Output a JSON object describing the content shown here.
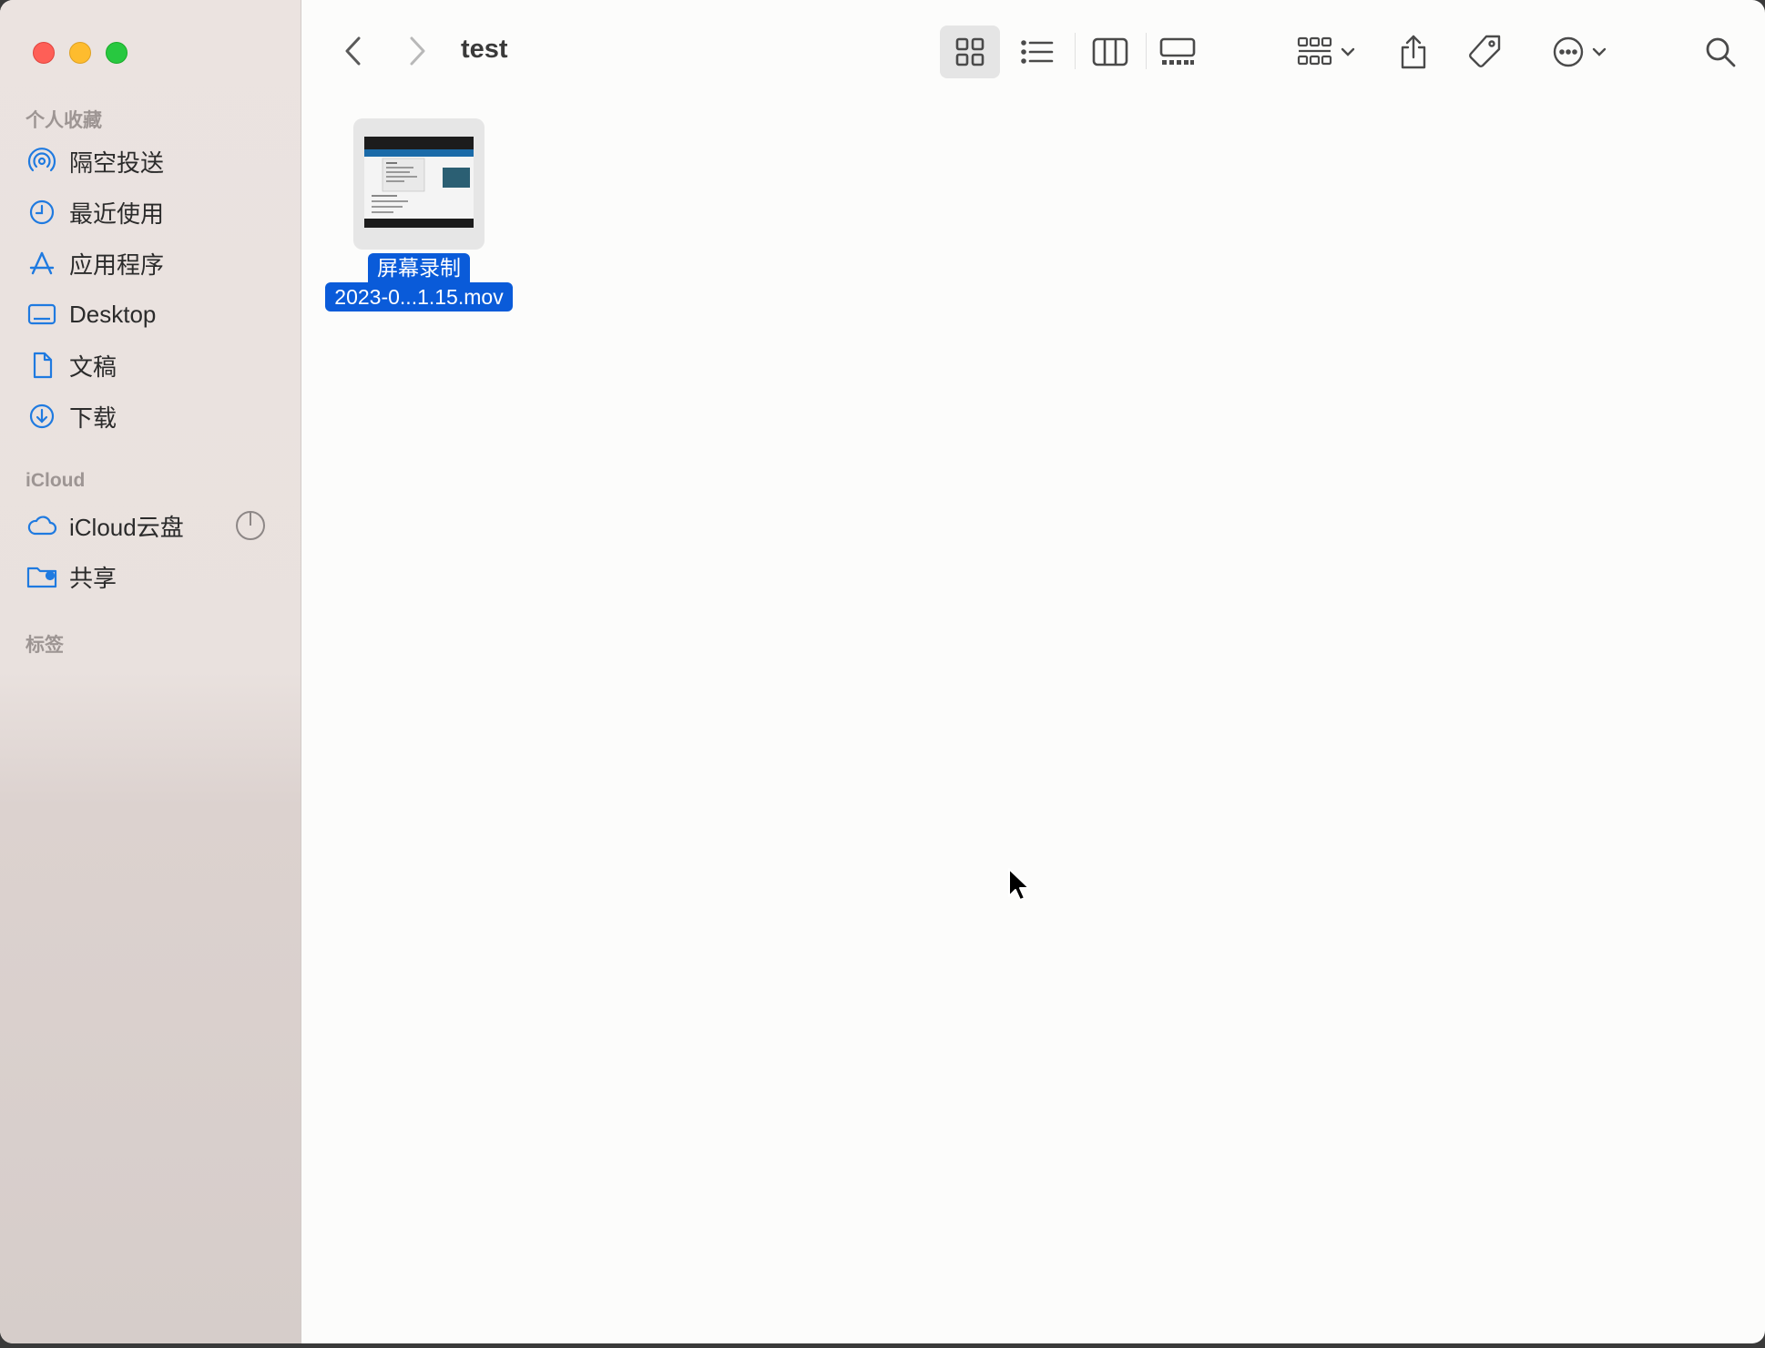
{
  "window": {
    "title": "test"
  },
  "sidebar": {
    "favorites_label": "个人收藏",
    "favorites": [
      {
        "label": "隔空投送",
        "icon": "airdrop-icon"
      },
      {
        "label": "最近使用",
        "icon": "clock-icon"
      },
      {
        "label": "应用程序",
        "icon": "applications-icon"
      },
      {
        "label": "Desktop",
        "icon": "desktop-icon"
      },
      {
        "label": "文稿",
        "icon": "document-icon"
      },
      {
        "label": "下载",
        "icon": "download-icon"
      }
    ],
    "icloud_label": "iCloud",
    "icloud": [
      {
        "label": "iCloud云盘",
        "icon": "cloud-icon"
      },
      {
        "label": "共享",
        "icon": "shared-folder-icon"
      }
    ],
    "tags_label": "标签"
  },
  "files": [
    {
      "name_line1": "屏幕录制",
      "name_line2": "2023-0...1.15.mov",
      "selected": true,
      "icon": "video-thumbnail"
    }
  ],
  "colors": {
    "accent": "#0a5bd9",
    "sidebar_icon": "#1f7ae0",
    "close": "#fe5f57",
    "minimize": "#febc2e",
    "zoom": "#28c840"
  }
}
